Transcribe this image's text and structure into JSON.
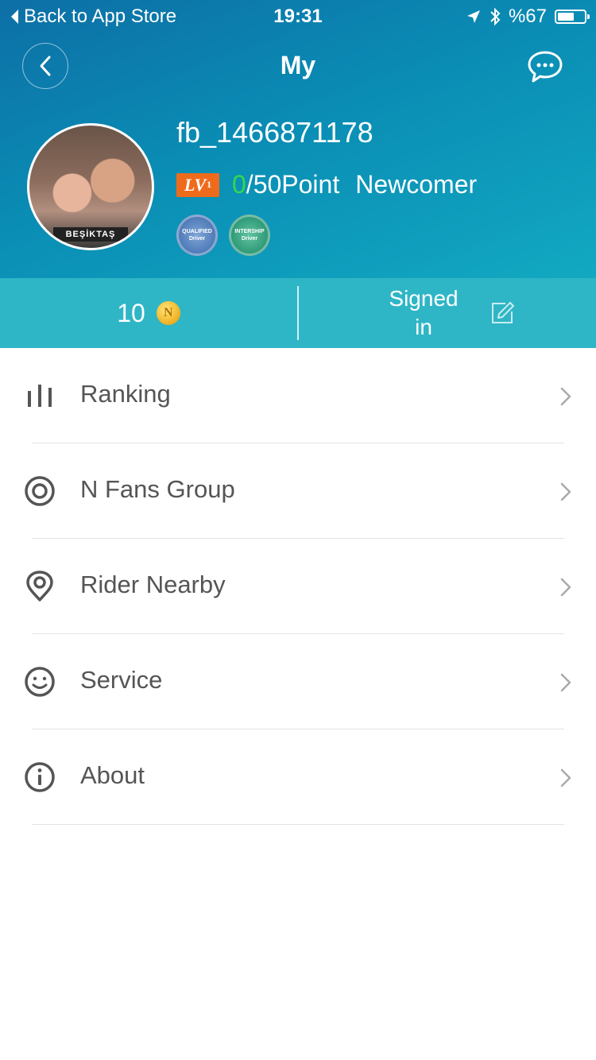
{
  "status_bar": {
    "back_label": "Back to App Store",
    "time": "19:31",
    "battery": "%67",
    "battery_level": 0.67
  },
  "nav": {
    "title": "My"
  },
  "profile": {
    "username": "fb_1466871178",
    "level_label": "LV",
    "level_num": "1",
    "points_current": "0",
    "points_total": "/50Point",
    "rank": "Newcomer",
    "avatar_banner": "BEŞİKTAŞ",
    "medals": [
      {
        "text": "QUALIFIED Driver",
        "color": "#4f7bb8"
      },
      {
        "text": "INTERSHIP Driver",
        "color": "#2f9a78"
      }
    ]
  },
  "stats": {
    "coins": "10",
    "coin_symbol": "N",
    "signed_in": "Signed in"
  },
  "menu": {
    "items": [
      {
        "label": "Ranking",
        "icon": "bar-chart-icon"
      },
      {
        "label": "N Fans Group",
        "icon": "target-icon"
      },
      {
        "label": "Rider Nearby",
        "icon": "location-pin-icon"
      },
      {
        "label": "Service",
        "icon": "smiley-icon"
      },
      {
        "label": "About",
        "icon": "info-icon"
      }
    ]
  },
  "colors": {
    "header_start": "#0d6fa6",
    "header_end": "#12a9c2",
    "stats_bar": "#2fb6c6",
    "level_badge": "#ef6b1c",
    "points_current": "#37d84a"
  }
}
